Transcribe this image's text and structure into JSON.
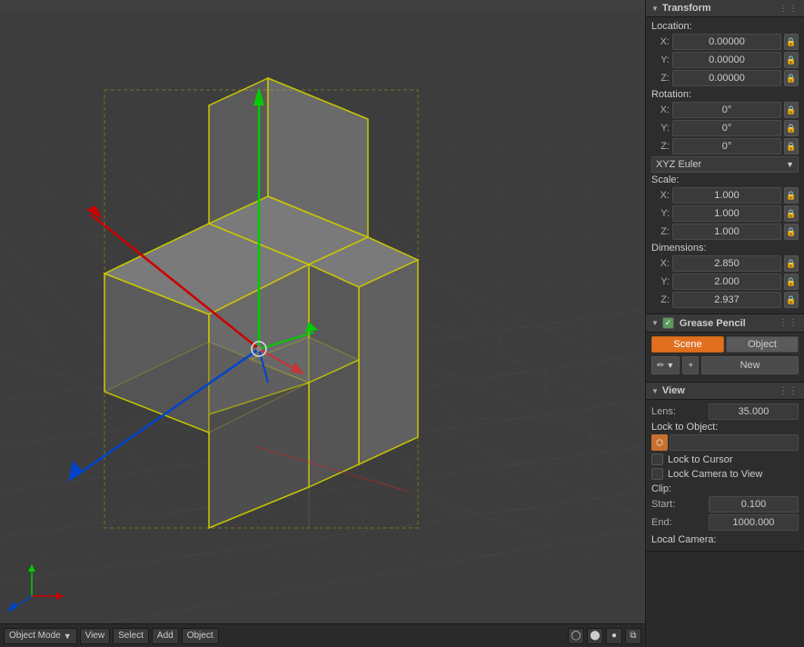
{
  "viewport": {
    "background_color": "#3d3d3d"
  },
  "transform_panel": {
    "title": "Transform",
    "location_label": "Location:",
    "location": {
      "x_label": "X:",
      "x_value": "0.00000",
      "y_label": "Y:",
      "y_value": "0.00000",
      "z_label": "Z:",
      "z_value": "0.00000"
    },
    "rotation_label": "Rotation:",
    "rotation": {
      "x_label": "X:",
      "x_value": "0°",
      "y_label": "Y:",
      "y_value": "0°",
      "z_label": "Z:",
      "z_value": "0°"
    },
    "euler_mode": "XYZ Euler",
    "scale_label": "Scale:",
    "scale": {
      "x_label": "X:",
      "x_value": "1.000",
      "y_label": "Y:",
      "y_value": "1.000",
      "z_label": "Z:",
      "z_value": "1.000"
    },
    "dimensions_label": "Dimensions:",
    "dimensions": {
      "x_label": "X:",
      "x_value": "2.850",
      "y_label": "Y:",
      "y_value": "2.000",
      "z_label": "Z:",
      "z_value": "2.937"
    }
  },
  "grease_pencil_panel": {
    "title": "Grease Pencil",
    "tab_scene": "Scene",
    "tab_object": "Object",
    "new_label": "New"
  },
  "view_panel": {
    "title": "View",
    "lens_label": "Lens:",
    "lens_value": "35.000",
    "lock_object_label": "Lock to Object:",
    "lock_cursor_label": "Lock to Cursor",
    "lock_camera_label": "Lock Camera to View",
    "clip_label": "Clip:",
    "start_label": "Start:",
    "start_value": "0.100",
    "end_label": "End:",
    "end_value": "1000.000",
    "local_camera_label": "Local Camera:"
  },
  "toolbar": {
    "mode_label": "Object Mode",
    "view_label": "View",
    "select_label": "Select",
    "add_label": "Add",
    "object_label": "Object"
  }
}
